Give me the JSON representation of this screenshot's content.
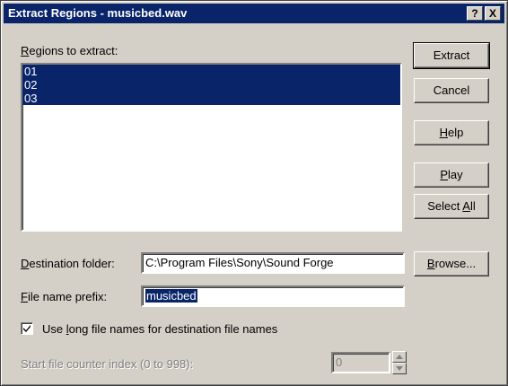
{
  "window": {
    "title": "Extract Regions - musicbed.wav"
  },
  "title_buttons": {
    "help": "?",
    "close": "X"
  },
  "regions": {
    "label_key": "R",
    "label_rest": "egions to extract:",
    "items": [
      "01",
      "02",
      "03"
    ]
  },
  "buttons": {
    "extract": "Extract",
    "cancel": "Cancel",
    "help_key": "H",
    "help_rest": "elp",
    "play_key": "P",
    "play_rest": "lay",
    "selectall_pre": "Select ",
    "selectall_key": "A",
    "selectall_rest": "ll",
    "browse_key": "B",
    "browse_rest": "rowse..."
  },
  "destination": {
    "label_key": "D",
    "label_rest": "estination folder:",
    "value": "C:\\Program Files\\Sony\\Sound Forge"
  },
  "prefix": {
    "label_key": "F",
    "label_rest": "ile name prefix:",
    "value": "musicbed"
  },
  "long_names": {
    "checked": true,
    "label_pre": "Use ",
    "label_key": "l",
    "label_rest": "ong file names for destination file names"
  },
  "counter": {
    "label": "Start file counter index (0 to 998):",
    "value": "0"
  }
}
